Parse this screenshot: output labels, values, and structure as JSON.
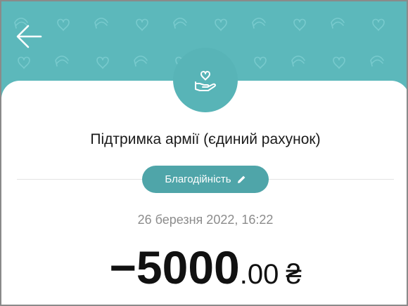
{
  "header": {
    "background_color": "#5cb8bb",
    "back_icon": "arrow-left-icon",
    "pattern_icons": [
      "heart-outline-icon",
      "hand-icon"
    ]
  },
  "transaction": {
    "icon": "heart-in-hand-icon",
    "title": "Підтримка армії (єдиний рахунок)",
    "category_label": "Благодійність",
    "category_icon": "pencil-icon",
    "date": "26 березня 2022, 16:22",
    "amount_sign": "−",
    "amount_integer": "5000",
    "amount_decimal": ".00",
    "currency_symbol": "₴"
  },
  "colors": {
    "accent": "#5cb8bb",
    "chip": "#4fa5a9",
    "secondary_text": "#8c8c8c"
  }
}
